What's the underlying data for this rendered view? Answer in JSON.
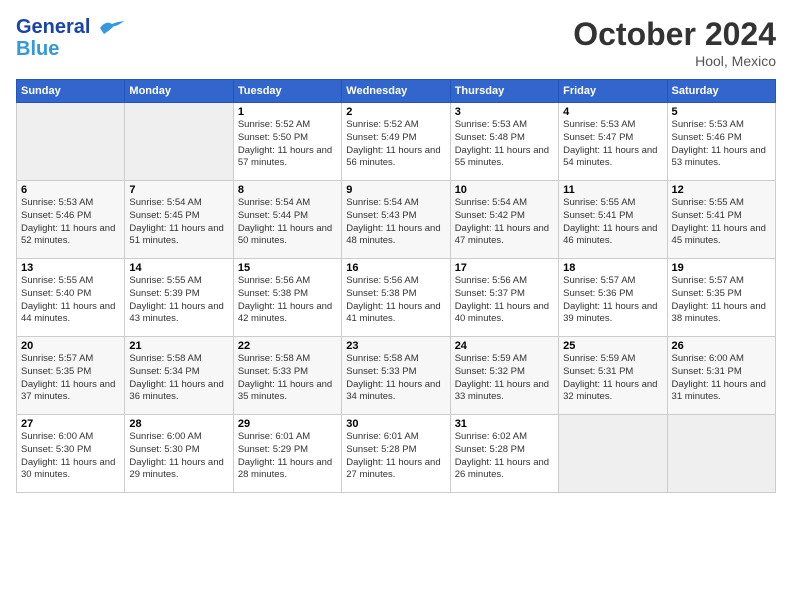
{
  "header": {
    "logo_line1": "General",
    "logo_line2": "Blue",
    "month": "October 2024",
    "location": "Hool, Mexico"
  },
  "days_of_week": [
    "Sunday",
    "Monday",
    "Tuesday",
    "Wednesday",
    "Thursday",
    "Friday",
    "Saturday"
  ],
  "weeks": [
    [
      {
        "day": "",
        "sunrise": "",
        "sunset": "",
        "daylight": ""
      },
      {
        "day": "",
        "sunrise": "",
        "sunset": "",
        "daylight": ""
      },
      {
        "day": "1",
        "sunrise": "Sunrise: 5:52 AM",
        "sunset": "Sunset: 5:50 PM",
        "daylight": "Daylight: 11 hours and 57 minutes."
      },
      {
        "day": "2",
        "sunrise": "Sunrise: 5:52 AM",
        "sunset": "Sunset: 5:49 PM",
        "daylight": "Daylight: 11 hours and 56 minutes."
      },
      {
        "day": "3",
        "sunrise": "Sunrise: 5:53 AM",
        "sunset": "Sunset: 5:48 PM",
        "daylight": "Daylight: 11 hours and 55 minutes."
      },
      {
        "day": "4",
        "sunrise": "Sunrise: 5:53 AM",
        "sunset": "Sunset: 5:47 PM",
        "daylight": "Daylight: 11 hours and 54 minutes."
      },
      {
        "day": "5",
        "sunrise": "Sunrise: 5:53 AM",
        "sunset": "Sunset: 5:46 PM",
        "daylight": "Daylight: 11 hours and 53 minutes."
      }
    ],
    [
      {
        "day": "6",
        "sunrise": "Sunrise: 5:53 AM",
        "sunset": "Sunset: 5:46 PM",
        "daylight": "Daylight: 11 hours and 52 minutes."
      },
      {
        "day": "7",
        "sunrise": "Sunrise: 5:54 AM",
        "sunset": "Sunset: 5:45 PM",
        "daylight": "Daylight: 11 hours and 51 minutes."
      },
      {
        "day": "8",
        "sunrise": "Sunrise: 5:54 AM",
        "sunset": "Sunset: 5:44 PM",
        "daylight": "Daylight: 11 hours and 50 minutes."
      },
      {
        "day": "9",
        "sunrise": "Sunrise: 5:54 AM",
        "sunset": "Sunset: 5:43 PM",
        "daylight": "Daylight: 11 hours and 48 minutes."
      },
      {
        "day": "10",
        "sunrise": "Sunrise: 5:54 AM",
        "sunset": "Sunset: 5:42 PM",
        "daylight": "Daylight: 11 hours and 47 minutes."
      },
      {
        "day": "11",
        "sunrise": "Sunrise: 5:55 AM",
        "sunset": "Sunset: 5:41 PM",
        "daylight": "Daylight: 11 hours and 46 minutes."
      },
      {
        "day": "12",
        "sunrise": "Sunrise: 5:55 AM",
        "sunset": "Sunset: 5:41 PM",
        "daylight": "Daylight: 11 hours and 45 minutes."
      }
    ],
    [
      {
        "day": "13",
        "sunrise": "Sunrise: 5:55 AM",
        "sunset": "Sunset: 5:40 PM",
        "daylight": "Daylight: 11 hours and 44 minutes."
      },
      {
        "day": "14",
        "sunrise": "Sunrise: 5:55 AM",
        "sunset": "Sunset: 5:39 PM",
        "daylight": "Daylight: 11 hours and 43 minutes."
      },
      {
        "day": "15",
        "sunrise": "Sunrise: 5:56 AM",
        "sunset": "Sunset: 5:38 PM",
        "daylight": "Daylight: 11 hours and 42 minutes."
      },
      {
        "day": "16",
        "sunrise": "Sunrise: 5:56 AM",
        "sunset": "Sunset: 5:38 PM",
        "daylight": "Daylight: 11 hours and 41 minutes."
      },
      {
        "day": "17",
        "sunrise": "Sunrise: 5:56 AM",
        "sunset": "Sunset: 5:37 PM",
        "daylight": "Daylight: 11 hours and 40 minutes."
      },
      {
        "day": "18",
        "sunrise": "Sunrise: 5:57 AM",
        "sunset": "Sunset: 5:36 PM",
        "daylight": "Daylight: 11 hours and 39 minutes."
      },
      {
        "day": "19",
        "sunrise": "Sunrise: 5:57 AM",
        "sunset": "Sunset: 5:35 PM",
        "daylight": "Daylight: 11 hours and 38 minutes."
      }
    ],
    [
      {
        "day": "20",
        "sunrise": "Sunrise: 5:57 AM",
        "sunset": "Sunset: 5:35 PM",
        "daylight": "Daylight: 11 hours and 37 minutes."
      },
      {
        "day": "21",
        "sunrise": "Sunrise: 5:58 AM",
        "sunset": "Sunset: 5:34 PM",
        "daylight": "Daylight: 11 hours and 36 minutes."
      },
      {
        "day": "22",
        "sunrise": "Sunrise: 5:58 AM",
        "sunset": "Sunset: 5:33 PM",
        "daylight": "Daylight: 11 hours and 35 minutes."
      },
      {
        "day": "23",
        "sunrise": "Sunrise: 5:58 AM",
        "sunset": "Sunset: 5:33 PM",
        "daylight": "Daylight: 11 hours and 34 minutes."
      },
      {
        "day": "24",
        "sunrise": "Sunrise: 5:59 AM",
        "sunset": "Sunset: 5:32 PM",
        "daylight": "Daylight: 11 hours and 33 minutes."
      },
      {
        "day": "25",
        "sunrise": "Sunrise: 5:59 AM",
        "sunset": "Sunset: 5:31 PM",
        "daylight": "Daylight: 11 hours and 32 minutes."
      },
      {
        "day": "26",
        "sunrise": "Sunrise: 6:00 AM",
        "sunset": "Sunset: 5:31 PM",
        "daylight": "Daylight: 11 hours and 31 minutes."
      }
    ],
    [
      {
        "day": "27",
        "sunrise": "Sunrise: 6:00 AM",
        "sunset": "Sunset: 5:30 PM",
        "daylight": "Daylight: 11 hours and 30 minutes."
      },
      {
        "day": "28",
        "sunrise": "Sunrise: 6:00 AM",
        "sunset": "Sunset: 5:30 PM",
        "daylight": "Daylight: 11 hours and 29 minutes."
      },
      {
        "day": "29",
        "sunrise": "Sunrise: 6:01 AM",
        "sunset": "Sunset: 5:29 PM",
        "daylight": "Daylight: 11 hours and 28 minutes."
      },
      {
        "day": "30",
        "sunrise": "Sunrise: 6:01 AM",
        "sunset": "Sunset: 5:28 PM",
        "daylight": "Daylight: 11 hours and 27 minutes."
      },
      {
        "day": "31",
        "sunrise": "Sunrise: 6:02 AM",
        "sunset": "Sunset: 5:28 PM",
        "daylight": "Daylight: 11 hours and 26 minutes."
      },
      {
        "day": "",
        "sunrise": "",
        "sunset": "",
        "daylight": ""
      },
      {
        "day": "",
        "sunrise": "",
        "sunset": "",
        "daylight": ""
      }
    ]
  ]
}
